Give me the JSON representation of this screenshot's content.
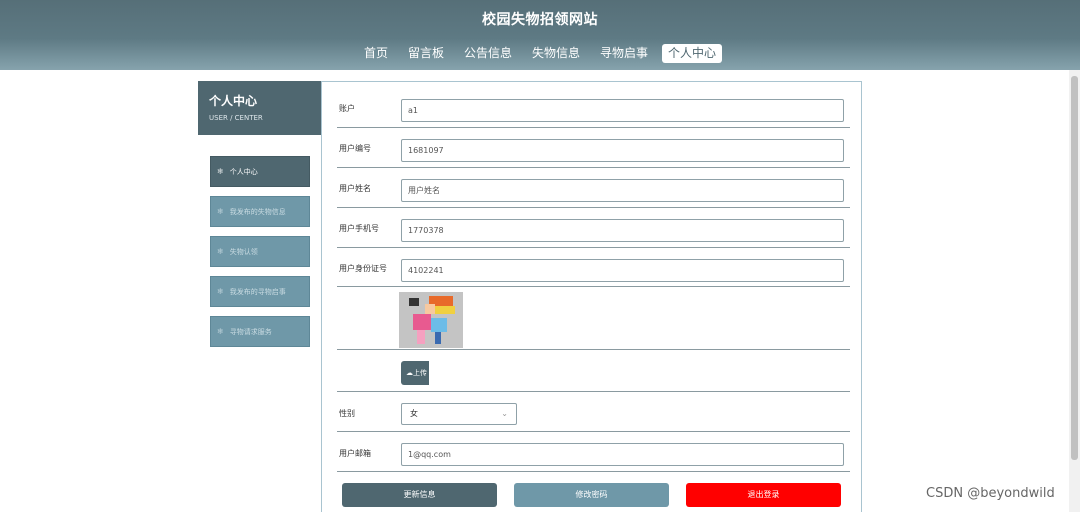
{
  "site": {
    "title": "校园失物招领网站"
  },
  "nav": {
    "items": [
      {
        "label": "首页"
      },
      {
        "label": "留言板"
      },
      {
        "label": "公告信息"
      },
      {
        "label": "失物信息"
      },
      {
        "label": "寻物启事"
      },
      {
        "label": "个人中心",
        "active": true
      }
    ]
  },
  "sidebar": {
    "title": "个人中心",
    "subtitle": "USER / CENTER",
    "items": [
      {
        "label": "个人中心",
        "active": true
      },
      {
        "label": "我发布的失物信息"
      },
      {
        "label": "失物认领"
      },
      {
        "label": "我发布的寻物启事"
      },
      {
        "label": "寻物请求服务"
      }
    ]
  },
  "form": {
    "account": {
      "label": "账户",
      "value": "a1"
    },
    "user_no": {
      "label": "用户编号",
      "value": "1681097"
    },
    "user_name": {
      "label": "用户姓名",
      "value": "用户姓名"
    },
    "phone": {
      "label": "用户手机号",
      "value": "1770378"
    },
    "id_card": {
      "label": "用户身份证号",
      "value": "4102241"
    },
    "upload_label": "上传",
    "gender": {
      "label": "性别",
      "value": "女"
    },
    "email": {
      "label": "用户邮箱",
      "value": "1@qq.com"
    }
  },
  "buttons": {
    "update": "更新信息",
    "change_password": "修改密码",
    "logout": "退出登录"
  },
  "colors": {
    "primary": "#4f6770",
    "secondary": "#6f98a8",
    "danger": "#ff0000"
  },
  "watermark": "CSDN @beyondwild"
}
